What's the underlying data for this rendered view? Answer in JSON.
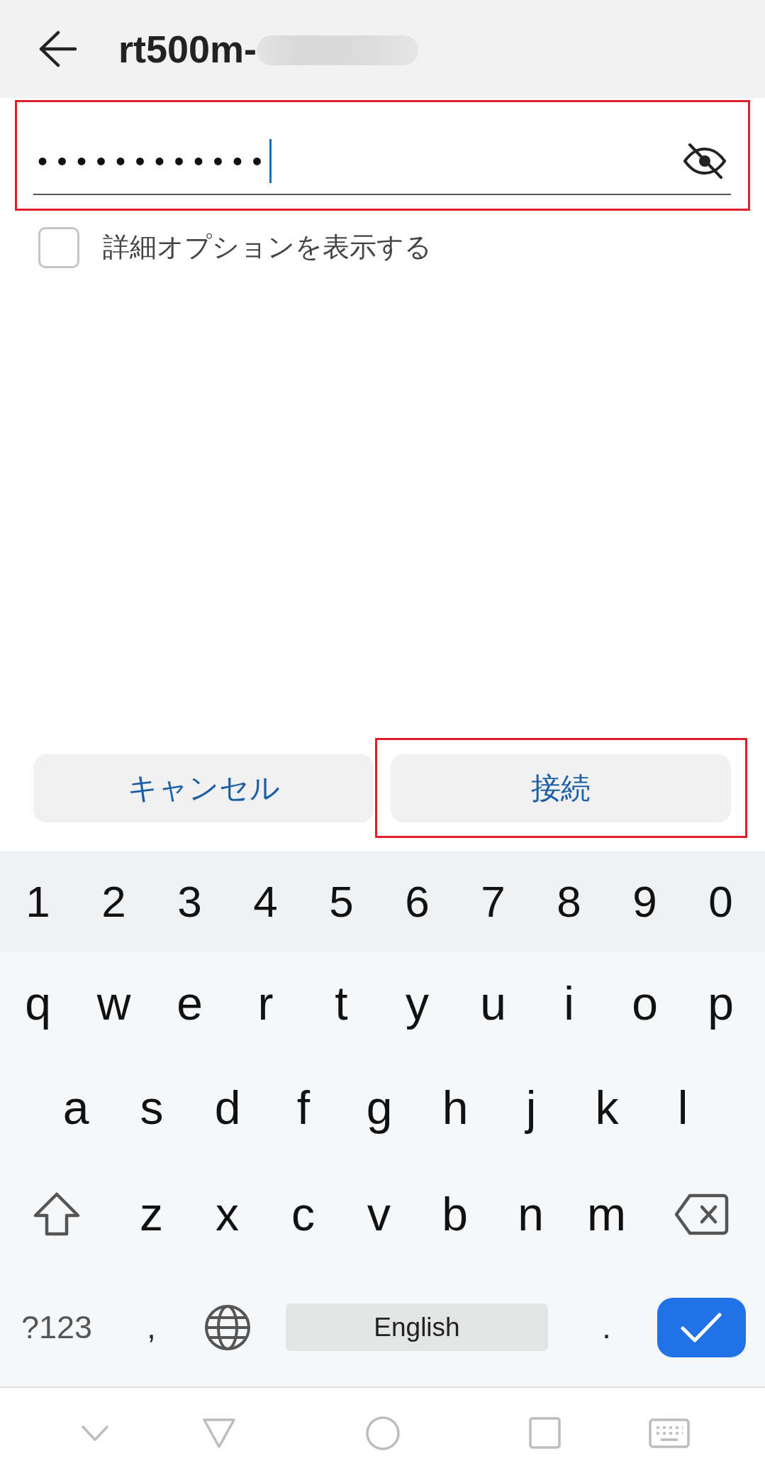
{
  "header": {
    "title": "rt500m-",
    "title_redacted": true
  },
  "password_field": {
    "value": "••••••••••••",
    "focused": true,
    "password_visible": false,
    "highlighted": true
  },
  "advanced_options": {
    "label": "詳細オプションを表示する",
    "checked": false
  },
  "buttons": [
    {
      "label": "キャンセル",
      "highlighted": false
    },
    {
      "label": "接続",
      "highlighted": true
    }
  ],
  "keyboard": {
    "number_row": [
      "1",
      "2",
      "3",
      "4",
      "5",
      "6",
      "7",
      "8",
      "9",
      "0"
    ],
    "letter_rows": [
      [
        "q",
        "w",
        "e",
        "r",
        "t",
        "y",
        "u",
        "i",
        "o",
        "p"
      ],
      [
        "a",
        "s",
        "d",
        "f",
        "g",
        "h",
        "j",
        "k",
        "l"
      ],
      [
        "z",
        "x",
        "c",
        "v",
        "b",
        "n",
        "m"
      ]
    ],
    "shift_active": false,
    "bottom_row": [
      {
        "kind": "symbols",
        "label": "?123"
      },
      {
        "kind": "char",
        "label": ","
      },
      {
        "kind": "globe"
      },
      {
        "kind": "space",
        "label": "English"
      },
      {
        "kind": "char",
        "label": "."
      },
      {
        "kind": "enter"
      }
    ]
  },
  "nav_bar": [
    {
      "kind": "collapse"
    },
    {
      "kind": "back"
    },
    {
      "kind": "home"
    },
    {
      "kind": "recents"
    },
    {
      "kind": "keyboard"
    }
  ]
}
